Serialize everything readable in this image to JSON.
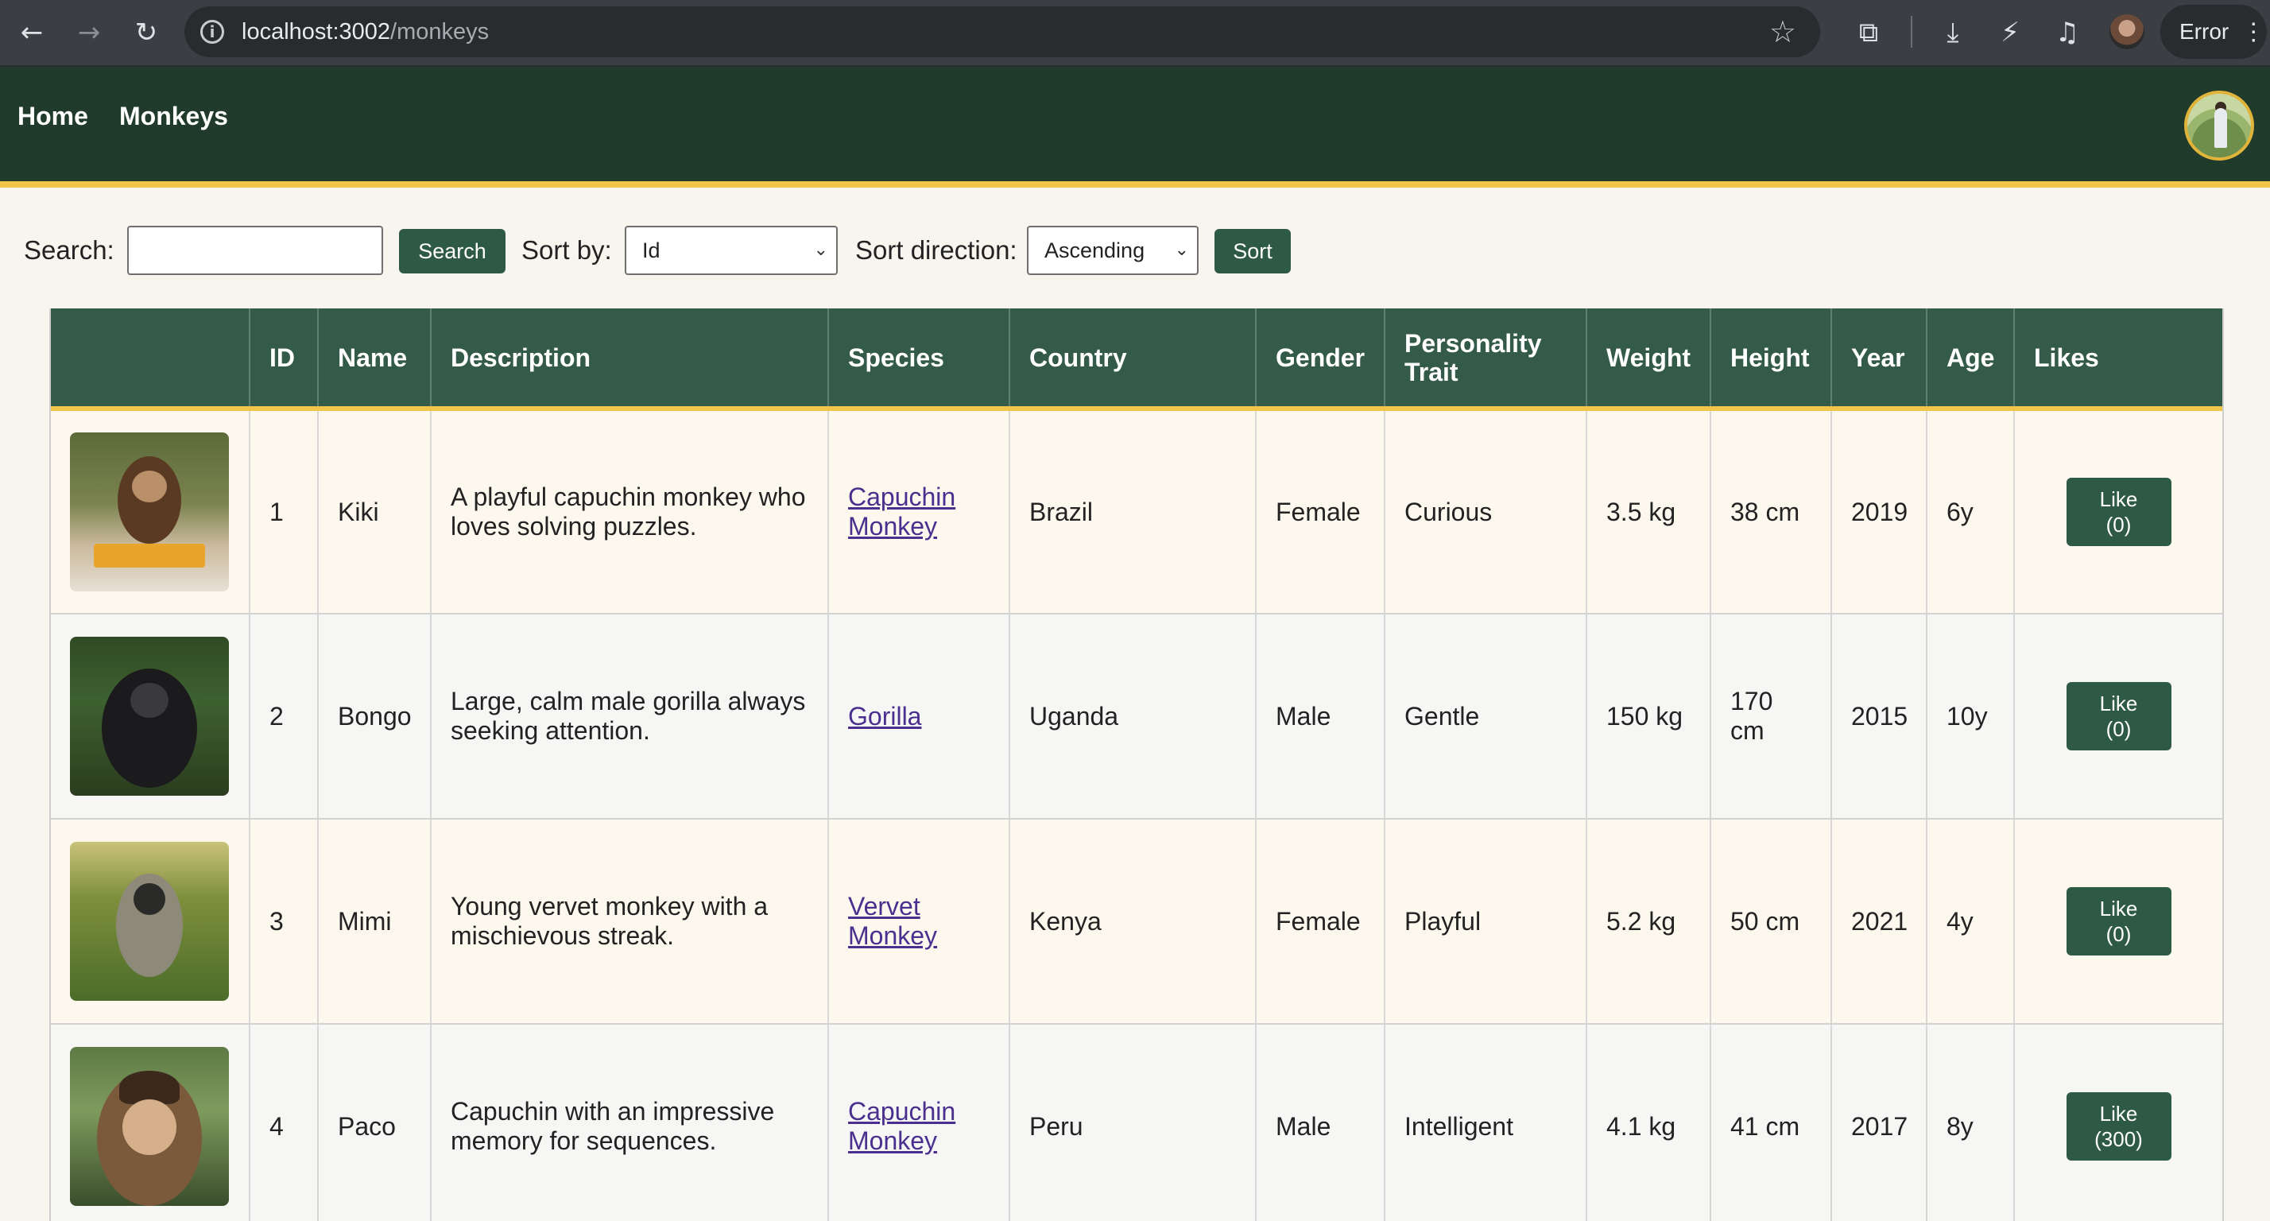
{
  "browser": {
    "url_host": "localhost:3002",
    "url_path": "/monkeys",
    "profile_status": "Error"
  },
  "nav": {
    "home": "Home",
    "monkeys": "Monkeys"
  },
  "controls": {
    "search_label": "Search:",
    "search_value": "",
    "search_button": "Search",
    "sort_by_label": "Sort by:",
    "sort_by_value": "Id",
    "sort_direction_label": "Sort direction:",
    "sort_direction_value": "Ascending",
    "sort_button": "Sort"
  },
  "table": {
    "headers": [
      "",
      "ID",
      "Name",
      "Description",
      "Species",
      "Country",
      "Gender",
      "Personality Trait",
      "Weight",
      "Height",
      "Year",
      "Age",
      "Likes"
    ],
    "like_label": "Like",
    "rows": [
      {
        "id": "1",
        "name": "Kiki",
        "description": "A playful capuchin monkey who loves solving puzzles.",
        "species": "Capuchin Monkey",
        "country": "Brazil",
        "gender": "Female",
        "trait": "Curious",
        "weight": "3.5 kg",
        "height": "38 cm",
        "year": "2019",
        "age": "6y",
        "likes": "(0)"
      },
      {
        "id": "2",
        "name": "Bongo",
        "description": "Large, calm male gorilla always seeking attention.",
        "species": "Gorilla",
        "country": "Uganda",
        "gender": "Male",
        "trait": "Gentle",
        "weight": "150 kg",
        "height": "170 cm",
        "year": "2015",
        "age": "10y",
        "likes": "(0)"
      },
      {
        "id": "3",
        "name": "Mimi",
        "description": "Young vervet monkey with a mischievous streak.",
        "species": "Vervet Monkey",
        "country": "Kenya",
        "gender": "Female",
        "trait": "Playful",
        "weight": "5.2 kg",
        "height": "50 cm",
        "year": "2021",
        "age": "4y",
        "likes": "(0)"
      },
      {
        "id": "4",
        "name": "Paco",
        "description": "Capuchin with an impressive memory for sequences.",
        "species": "Capuchin Monkey",
        "country": "Peru",
        "gender": "Male",
        "trait": "Intelligent",
        "weight": "4.1 kg",
        "height": "41 cm",
        "year": "2017",
        "age": "8y",
        "likes": "(300)"
      }
    ]
  },
  "colors": {
    "header_bg": "#203b2c",
    "accent_gold": "#f0c54a",
    "table_header_bg": "#345a49",
    "button_bg": "#2e5a45",
    "link": "#4a2f8f"
  }
}
